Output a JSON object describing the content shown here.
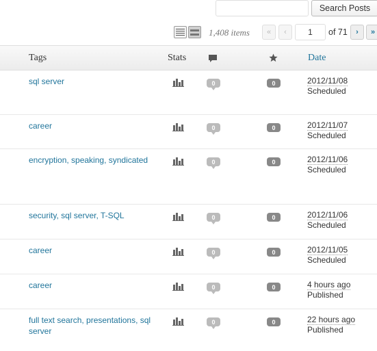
{
  "search": {
    "placeholder": "",
    "value": "",
    "button_label": "Search Posts"
  },
  "tablenav": {
    "items_count": "1,408 items",
    "first": "«",
    "prev": "‹",
    "current_page": "1",
    "of_pages": "of 71",
    "next": "›",
    "last": "»"
  },
  "columns": {
    "tags": "Tags",
    "stats": "Stats",
    "comments_icon": "comment-icon",
    "star_icon": "star-icon",
    "date": "Date"
  },
  "rows": [
    {
      "tags": "sql server",
      "comments": "0",
      "stars": "0",
      "date": "2012/11/08",
      "status": "Scheduled"
    },
    {
      "tags": "career",
      "comments": "0",
      "stars": "0",
      "date": "2012/11/07",
      "status": "Scheduled"
    },
    {
      "tags": "encryption, speaking, syndicated",
      "comments": "0",
      "stars": "0",
      "date": "2012/11/06",
      "status": "Scheduled"
    },
    {
      "tags": "security, sql server, T-SQL",
      "comments": "0",
      "stars": "0",
      "date": "2012/11/06",
      "status": "Scheduled"
    },
    {
      "tags": "career",
      "comments": "0",
      "stars": "0",
      "date": "2012/11/05",
      "status": "Scheduled"
    },
    {
      "tags": "career",
      "comments": "0",
      "stars": "0",
      "date": "4 hours ago",
      "status": "Published"
    },
    {
      "tags": "full text search, presentations, sql server",
      "comments": "0",
      "stars": "0",
      "date": "22 hours ago",
      "status": "Published"
    }
  ],
  "colors": {
    "link": "#21759b",
    "bubble": "#bbbbbb",
    "badge": "#888888"
  }
}
